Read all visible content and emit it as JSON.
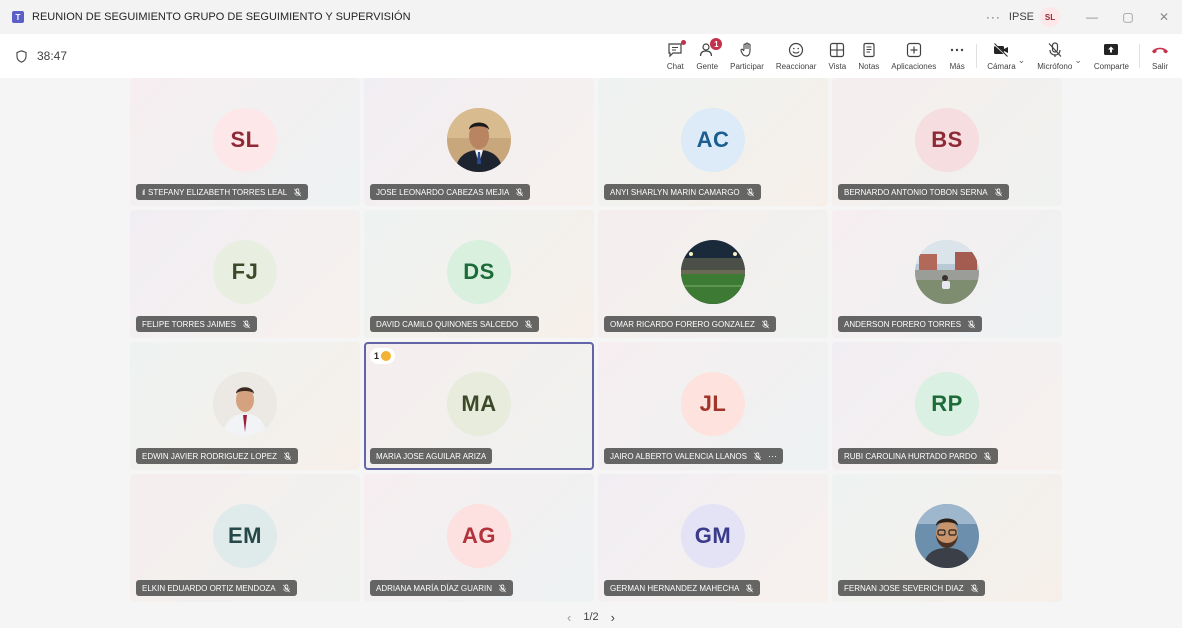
{
  "window": {
    "title": "REUNION DE SEGUIMIENTO GRUPO DE SEGUIMIENTO Y SUPERVISIÓN",
    "more": "···",
    "org": "IPSE",
    "me_initials": "SL"
  },
  "meeting": {
    "timer": "38:47"
  },
  "toolbar": {
    "chat": "Chat",
    "people": "Gente",
    "people_badge": "1",
    "raise": "Participar",
    "react": "Reaccionar",
    "view": "Vista",
    "notes": "Notas",
    "apps": "Aplicaciones",
    "more": "Más",
    "camera": "Cámara",
    "mic": "Micrófono",
    "share": "Comparte",
    "leave": "Salir"
  },
  "participants": [
    {
      "name": "STEFANY ELIZABETH TORRES LEAL",
      "initials": "SL",
      "bg": "#fde7e9",
      "fg": "#8e2a35"
    },
    {
      "name": "JOSE LEONARDO CABEZAS MEJIA",
      "initials": "",
      "photo": "man-suit"
    },
    {
      "name": "ANYI SHARLYN MARIN CAMARGO",
      "initials": "AC",
      "bg": "#dcebf7",
      "fg": "#1b5e8f"
    },
    {
      "name": "BERNARDO ANTONIO TOBON SERNA",
      "initials": "BS",
      "bg": "#f6dde0",
      "fg": "#8e2a35"
    },
    {
      "name": "FELIPE TORRES JAIMES",
      "initials": "FJ",
      "bg": "#e9efe0",
      "fg": "#3d4a2a"
    },
    {
      "name": "DAVID CAMILO QUINONES SALCEDO",
      "initials": "DS",
      "bg": "#d9f0df",
      "fg": "#1e6b3a"
    },
    {
      "name": "OMAR RICARDO FORERO GONZALEZ",
      "initials": "",
      "photo": "stadium"
    },
    {
      "name": "ANDERSON FORERO TORRES",
      "initials": "",
      "photo": "outdoor"
    },
    {
      "name": "EDWIN JAVIER RODRIGUEZ LOPEZ",
      "initials": "",
      "photo": "man-shirt"
    },
    {
      "name": "MARIA JOSE AGUILAR ARIZA",
      "initials": "MA",
      "bg": "#e7ecdd",
      "fg": "#3d4a2a",
      "hand": "1"
    },
    {
      "name": "JAIRO ALBERTO VALENCIA LLANOS",
      "initials": "JL",
      "bg": "#fde2dd",
      "fg": "#a0352a"
    },
    {
      "name": "RUBI CAROLINA HURTADO PARDO",
      "initials": "RP",
      "bg": "#daf0e2",
      "fg": "#1e6b3a"
    },
    {
      "name": "ELKIN EDUARDO ORTIZ MENDOZA",
      "initials": "EM",
      "bg": "#dfeaea",
      "fg": "#264848"
    },
    {
      "name": "ADRIANA MARÍA DÍAZ GUARIN",
      "initials": "AG",
      "bg": "#fde0e0",
      "fg": "#b2333a"
    },
    {
      "name": "GERMAN HERNANDEZ MAHECHA",
      "initials": "GM",
      "bg": "#e3e3f5",
      "fg": "#3b3b8c"
    },
    {
      "name": "FERNAN JOSE SEVERICH DIAZ",
      "initials": "",
      "photo": "man-glasses"
    }
  ],
  "pager": {
    "label": "1/2",
    "prev": "‹",
    "next": "›"
  }
}
